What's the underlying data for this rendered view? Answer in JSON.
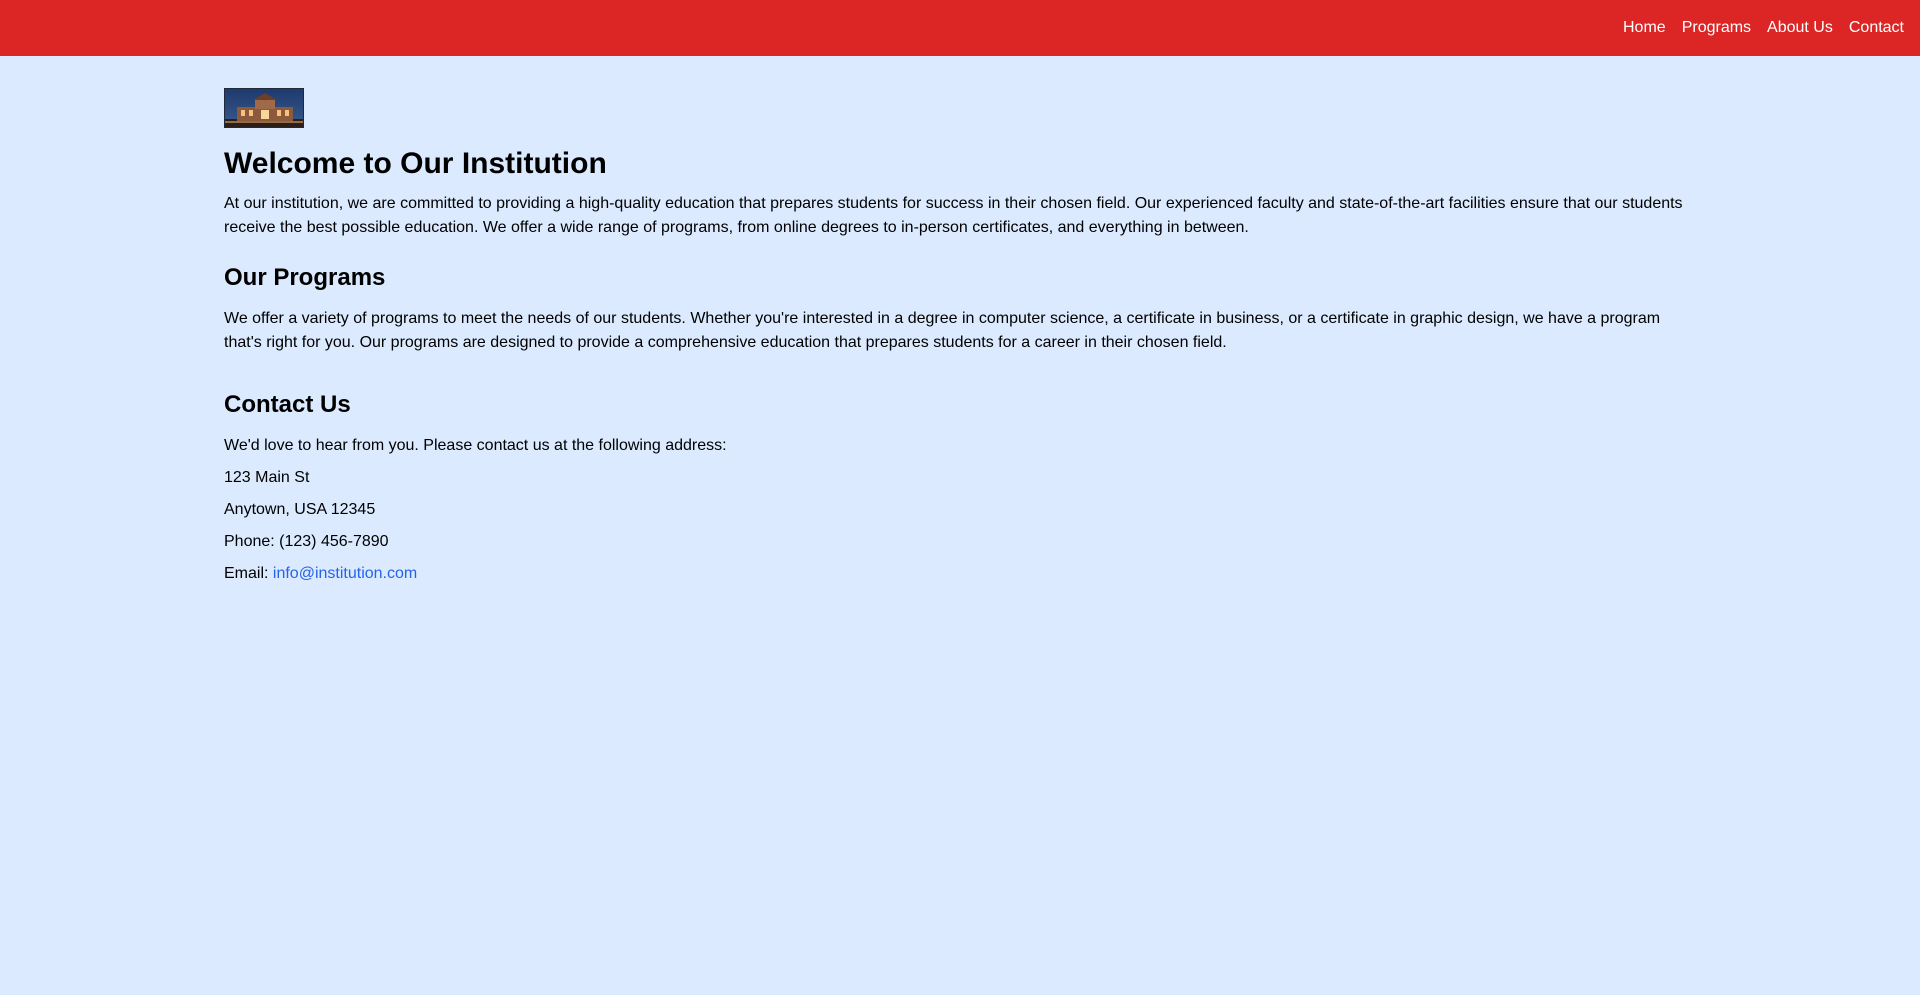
{
  "header": {
    "nav": [
      {
        "label": "Home"
      },
      {
        "label": "Programs"
      },
      {
        "label": "About Us"
      },
      {
        "label": "Contact"
      }
    ]
  },
  "welcome": {
    "title": "Welcome to Our Institution",
    "text": "At our institution, we are committed to providing a high-quality education that prepares students for success in their chosen field. Our experienced faculty and state-of-the-art facilities ensure that our students receive the best possible education. We offer a wide range of programs, from online degrees to in-person certificates, and everything in between."
  },
  "programs": {
    "title": "Our Programs",
    "text": "We offer a variety of programs to meet the needs of our students. Whether you're interested in a degree in computer science, a certificate in business, or a certificate in graphic design, we have a program that's right for you. Our programs are designed to provide a comprehensive education that prepares students for a career in their chosen field."
  },
  "contact": {
    "title": "Contact Us",
    "intro": "We'd love to hear from you. Please contact us at the following address:",
    "street": "123 Main St",
    "city": "Anytown, USA 12345",
    "phone": "Phone: (123) 456-7890",
    "email_label": "Email: ",
    "email": "info@institution.com"
  },
  "colors": {
    "header_bg": "#dc2626",
    "page_bg": "#dbeafe",
    "link": "#2563eb"
  },
  "icons": {
    "logo": "institution-building-image"
  }
}
